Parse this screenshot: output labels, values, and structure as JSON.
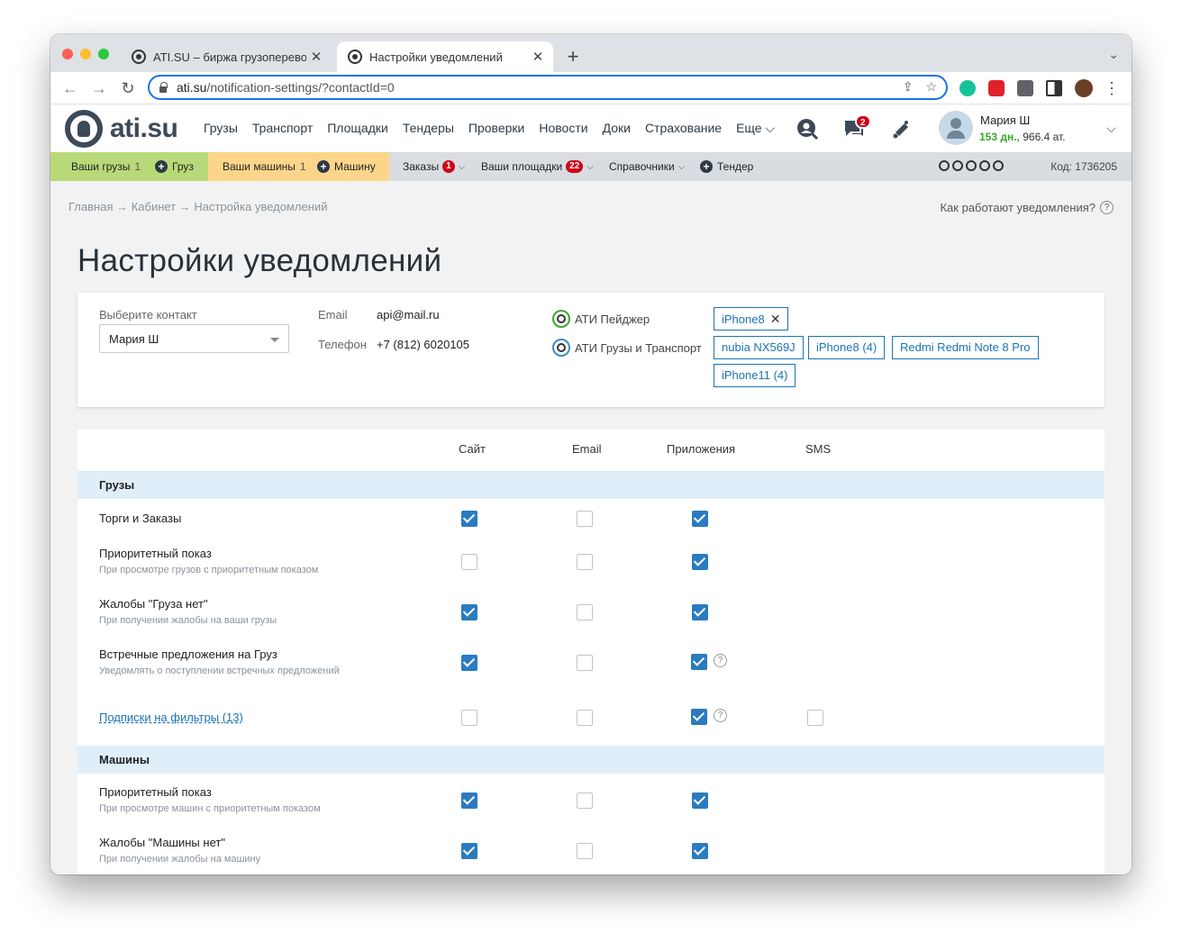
{
  "browser": {
    "tabs": [
      {
        "title": "ATI.SU – биржа грузоперевозок",
        "close": "✕"
      },
      {
        "title": "Настройки уведомлений",
        "close": "✕"
      }
    ],
    "new_tab": "+",
    "tab_menu": "⌄",
    "url_host": "ati.su",
    "url_path": "/notification-settings/?contactId=0",
    "back": "←",
    "forward": "→",
    "reload": "↻",
    "share": "⇪",
    "bookmark": "☆",
    "menu": "⋮"
  },
  "site": {
    "logo_text": "ati.su",
    "nav": [
      "Грузы",
      "Транспорт",
      "Площадки",
      "Тендеры",
      "Проверки",
      "Новости",
      "Доки",
      "Страхование",
      "Еще"
    ],
    "more_chevron": "⌵",
    "messages_badge": "2",
    "user": {
      "name": "Мария Ш",
      "days": "153 дн.,",
      "points": "966.4 ат."
    },
    "user_chevron": "⌵"
  },
  "subbar": {
    "your_cargo": "Ваши грузы",
    "your_cargo_count": "1",
    "add_cargo": "Груз",
    "your_trucks": "Ваши машины",
    "your_trucks_count": "1",
    "add_truck": "Машину",
    "orders": "Заказы",
    "orders_badge": "1",
    "platforms": "Ваши площадки",
    "platforms_badge": "22",
    "reference": "Справочники",
    "tender": "Тендер",
    "chevron": "⌵",
    "plus": "+",
    "code": "Код: 1736205"
  },
  "page": {
    "breadcrumb": "Главная → Кабинет → Настройка уведомлений",
    "help_link": "Как работают уведомления?",
    "help_icon": "?",
    "title": "Настройки уведомлений"
  },
  "contact": {
    "select_label": "Выберите контакт",
    "select_value": "Мария Ш",
    "email_label": "Email",
    "email_value": "api@mail.ru",
    "phone_label": "Телефон",
    "phone_value": "+7 (812) 6020105",
    "apps": [
      {
        "name": "АТИ Пейджер",
        "devices": [
          "iPhone8"
        ]
      },
      {
        "name": "АТИ Грузы и Транспорт",
        "devices": [
          "nubia NX569J",
          "iPhone8 (4)",
          "Redmi Redmi Note 8 Pro",
          "iPhone11 (4)"
        ]
      }
    ],
    "remove_icon": "✕"
  },
  "table": {
    "columns": [
      "Сайт",
      "Email",
      "Приложения",
      "SMS"
    ],
    "sections": [
      {
        "title": "Грузы",
        "rows": [
          {
            "title": "Торги и Заказы",
            "desc": "",
            "site": true,
            "email": false,
            "app": true
          },
          {
            "title": "Приоритетный показ",
            "desc": "При просмотре грузов с приоритетным показом",
            "site": false,
            "email": false,
            "app": true
          },
          {
            "title": "Жалобы \"Груза нет\"",
            "desc": "При получении жалобы на ваши грузы",
            "site": true,
            "email": false,
            "app": true
          },
          {
            "title": "Встречные предложения на Груз",
            "desc": "Уведомлять о поступлении встречных предложений",
            "site": true,
            "email": false,
            "app": true,
            "help": "?"
          },
          {
            "title": "Подписки на фильтры (13)",
            "desc": "",
            "link": true,
            "site": false,
            "email": false,
            "app": true,
            "sms": false,
            "help": "?"
          }
        ]
      },
      {
        "title": "Машины",
        "rows": [
          {
            "title": "Приоритетный показ",
            "desc": "При просмотре машин с приоритетным показом",
            "site": true,
            "email": false,
            "app": true
          },
          {
            "title": "Жалобы \"Машины нет\"",
            "desc": "При получении жалобы на машину",
            "site": true,
            "email": false,
            "app": true
          }
        ]
      }
    ]
  }
}
